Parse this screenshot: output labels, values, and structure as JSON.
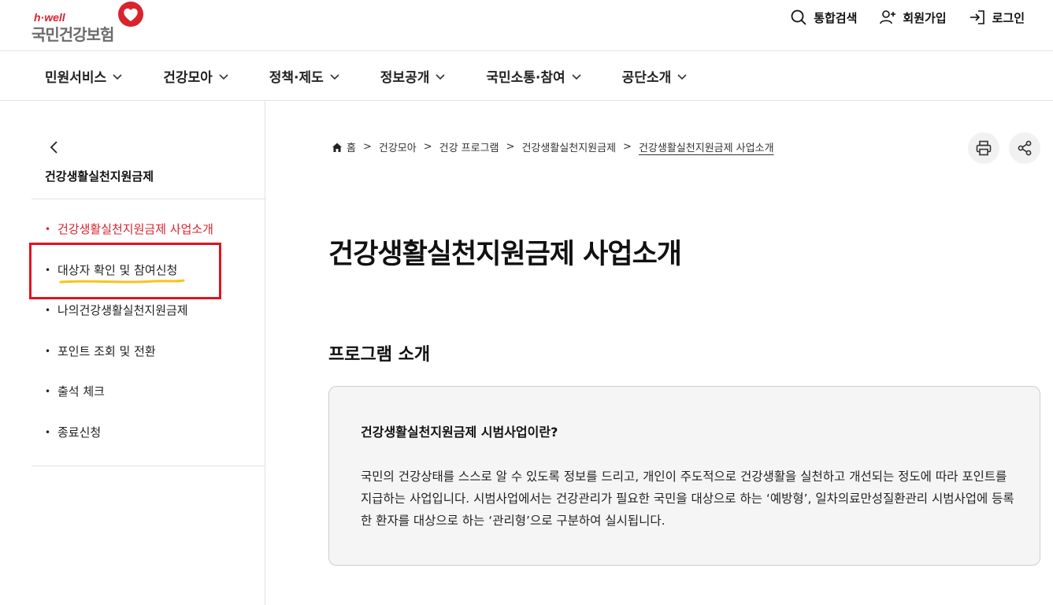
{
  "header": {
    "logo_sub": "h·well",
    "logo_name": "국민건강보험",
    "utils": {
      "search": "통합검색",
      "signup": "회원가입",
      "login": "로그인"
    }
  },
  "gnb": {
    "items": [
      "민원서비스",
      "건강모아",
      "정책·제도",
      "정보공개",
      "국민소통·참여",
      "공단소개"
    ]
  },
  "sidebar": {
    "title": "건강생활실천지원금제",
    "items": [
      {
        "label": "건강생활실천지원금제 사업소개"
      },
      {
        "label": "대상자 확인 및 참여신청"
      },
      {
        "label": "나의건강생활실천지원금제"
      },
      {
        "label": "포인트 조회 및 전환"
      },
      {
        "label": "출석 체크"
      },
      {
        "label": "종료신청"
      }
    ],
    "bullet": "•"
  },
  "breadcrumb": {
    "items": [
      "홈",
      "건강모아",
      "건강 프로그램",
      "건강생활실천지원금제",
      "건강생활실천지원금제 사업소개"
    ],
    "separator": ">"
  },
  "main": {
    "page_title": "건강생활실천지원금제 사업소개",
    "section_title": "프로그램 소개",
    "box_question": "건강생활실천지원금제 시범사업이란?",
    "box_desc": "국민의 건강상태를 스스로 알 수 있도록 정보를 드리고, 개인이 주도적으로 건강생활을 실천하고 개선되는 정도에 따라 포인트를 지급하는 사업입니다. 시범사업에서는 건강관리가 필요한 국민을 대상으로 하는 ‘예방형’, 일차의료만성질환관리 시범사업에 등록한 환자를 대상으로 하는 ‘관리형’으로 구분하여 실시됩니다."
  },
  "colors": {
    "brand_red": "#d9232d",
    "annotation_box": "#e3121c",
    "annotation_underline": "#f5c518"
  }
}
